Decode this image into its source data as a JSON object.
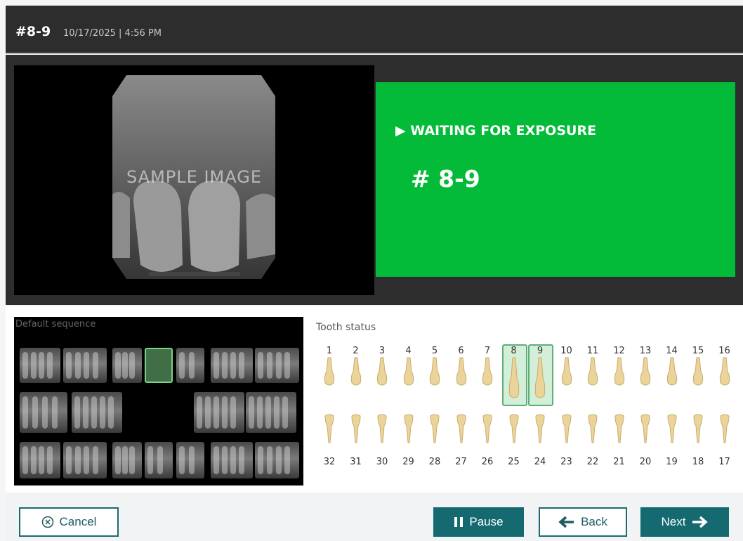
{
  "header": {
    "title": "#8-9",
    "meta": "10/17/2025 | 4:56 PM"
  },
  "image": {
    "watermark": "SAMPLE IMAGE"
  },
  "status": {
    "state": "WAITING FOR EXPOSURE",
    "tooth": "# 8-9",
    "color": "#04bb39"
  },
  "sequence": {
    "label": "Default sequence"
  },
  "tooth_status": {
    "label": "Tooth status",
    "upper": [
      "1",
      "2",
      "3",
      "4",
      "5",
      "6",
      "7",
      "8",
      "9",
      "10",
      "11",
      "12",
      "13",
      "14",
      "15",
      "16"
    ],
    "lower": [
      "32",
      "31",
      "30",
      "29",
      "28",
      "27",
      "26",
      "25",
      "24",
      "23",
      "22",
      "21",
      "20",
      "19",
      "18",
      "17"
    ],
    "selected": [
      "8",
      "9"
    ]
  },
  "footer": {
    "cancel": "Cancel",
    "pause": "Pause",
    "back": "Back",
    "next": "Next"
  },
  "colors": {
    "accent": "#146a70",
    "selected": "#5fae78"
  }
}
